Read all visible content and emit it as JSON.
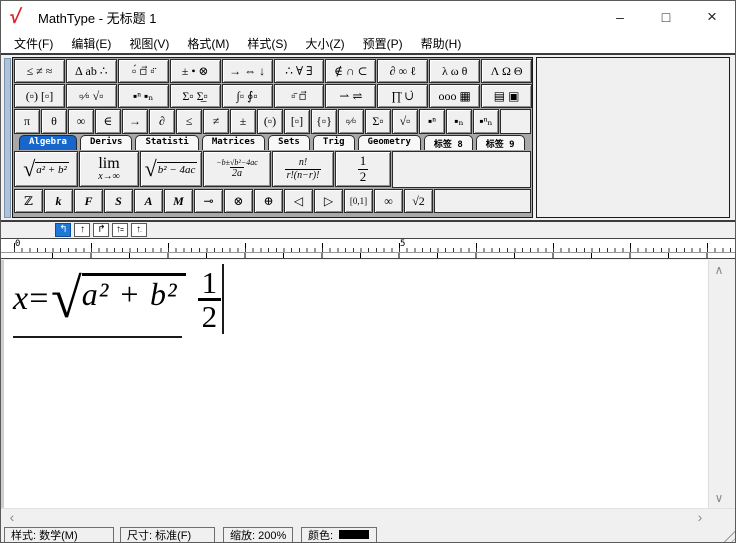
{
  "window": {
    "title": "MathType - 无标题 1",
    "logo_glyph": "√",
    "controls": {
      "minimize": "–",
      "maximize": "□",
      "close": "×"
    }
  },
  "colors": {
    "tab_selected": "#1666cc",
    "logo_red": "#d8232a",
    "grip_blue": "#aec2da",
    "status_color_value": "#000000"
  },
  "menu": {
    "items": [
      {
        "label": "文件(F)"
      },
      {
        "label": "编辑(E)"
      },
      {
        "label": "视图(V)"
      },
      {
        "label": "格式(M)"
      },
      {
        "label": "样式(S)"
      },
      {
        "label": "大小(Z)"
      },
      {
        "label": "预置(P)"
      },
      {
        "label": "帮助(H)"
      }
    ]
  },
  "palette_row1": [
    {
      "name": "relational-symbols",
      "glyph": "≤ ≠ ≈"
    },
    {
      "name": "spacing-ellipses",
      "glyph": "∆ ab ∴"
    },
    {
      "name": "embellishments",
      "glyph": "▫́ ▫⃗ ▫̈"
    },
    {
      "name": "operator-symbols",
      "glyph": "± • ⊗"
    },
    {
      "name": "arrow-symbols",
      "glyph": "→ ⇔ ↓"
    },
    {
      "name": "logic-symbols",
      "glyph": "∴ ∀ ∃"
    },
    {
      "name": "set-theory-symbols",
      "glyph": "∉ ∩ ⊂"
    },
    {
      "name": "misc-symbols",
      "glyph": "∂ ∞ ℓ"
    },
    {
      "name": "greek-lowercase",
      "glyph": "λ ω θ"
    },
    {
      "name": "greek-uppercase",
      "glyph": "Λ Ω Θ"
    }
  ],
  "palette_row2": [
    {
      "name": "fence-templates",
      "glyph": "(▫) [▫]"
    },
    {
      "name": "fraction-radical-templates",
      "glyph": "▫⁄▫ √▫"
    },
    {
      "name": "script-templates",
      "glyph": "▪ⁿ ▪ₙ"
    },
    {
      "name": "sum-templates",
      "glyph": "Σ▫ Σ̲▫"
    },
    {
      "name": "integral-templates",
      "glyph": "∫▫ ∮▫"
    },
    {
      "name": "overbar-templates",
      "glyph": "▫̄ ▫⃗"
    },
    {
      "name": "labeled-arrow-templates",
      "glyph": "⇀ ⇌"
    },
    {
      "name": "product-union-templates",
      "glyph": "∏̇ ∪̇"
    },
    {
      "name": "matrix-templates",
      "glyph": "ooo ▦"
    },
    {
      "name": "box-templates",
      "glyph": "▤ ▣"
    }
  ],
  "small_row": [
    {
      "name": "pi",
      "glyph": "π"
    },
    {
      "name": "theta",
      "glyph": "θ"
    },
    {
      "name": "infinity",
      "glyph": "∞"
    },
    {
      "name": "element-of",
      "glyph": "∈"
    },
    {
      "name": "right-arrow",
      "glyph": "→"
    },
    {
      "name": "partial",
      "glyph": "∂"
    },
    {
      "name": "less-equal",
      "glyph": "≤"
    },
    {
      "name": "not-equal",
      "glyph": "≠"
    },
    {
      "name": "plus-minus",
      "glyph": "±"
    },
    {
      "name": "parentheses",
      "glyph": "(▫)"
    },
    {
      "name": "brackets",
      "glyph": "[▫]"
    },
    {
      "name": "braces",
      "glyph": "{▫}"
    },
    {
      "name": "fraction",
      "glyph": "▫⁄▫"
    },
    {
      "name": "summation",
      "glyph": "Σ▫"
    },
    {
      "name": "square-root",
      "glyph": "√▫"
    },
    {
      "name": "superscript",
      "glyph": "▪ⁿ"
    },
    {
      "name": "subscript",
      "glyph": "▪ₙ"
    },
    {
      "name": "sub-superscript",
      "glyph": "▪ⁿₙ"
    }
  ],
  "tabs": {
    "items": [
      {
        "label": "Algebra",
        "selected": true
      },
      {
        "label": "Derivs",
        "selected": false
      },
      {
        "label": "Statisti",
        "selected": false
      },
      {
        "label": "Matrices",
        "selected": false
      },
      {
        "label": "Sets",
        "selected": false
      },
      {
        "label": "Trig",
        "selected": false
      },
      {
        "label": "Geometry",
        "selected": false
      },
      {
        "label": "标签 8",
        "selected": false
      },
      {
        "label": "标签 9",
        "selected": false
      }
    ]
  },
  "templates": [
    {
      "name": "sqrt-a2-plus-b2",
      "sign": "√",
      "radicand": "a² + b²"
    },
    {
      "name": "limit-x-to-infinity",
      "top": "lim",
      "bottom": "x→∞"
    },
    {
      "name": "sqrt-b2-minus-4ac",
      "sign": "√",
      "radicand": "b² − 4ac"
    },
    {
      "name": "quadratic-formula",
      "num": "−b±√b²−4ac",
      "den": "2a"
    },
    {
      "name": "combination-formula",
      "num": "n!",
      "den": "r!(n−r)!"
    },
    {
      "name": "one-half",
      "num": "1",
      "den": "2"
    }
  ],
  "char_row": [
    {
      "name": "blackboard-z",
      "glyph": "ℤ"
    },
    {
      "name": "letter-k",
      "glyph": "k"
    },
    {
      "name": "letter-f",
      "glyph": "F"
    },
    {
      "name": "letter-s",
      "glyph": "S"
    },
    {
      "name": "fraktur-a",
      "glyph": "A"
    },
    {
      "name": "fraktur-m",
      "glyph": "M"
    },
    {
      "name": "multimap",
      "glyph": "⊸"
    },
    {
      "name": "circled-times",
      "glyph": "⊗"
    },
    {
      "name": "circled-plus",
      "glyph": "⊕"
    },
    {
      "name": "triangle-left",
      "glyph": "◁"
    },
    {
      "name": "triangle-right",
      "glyph": "▷"
    },
    {
      "name": "interval-01",
      "glyph": "[0,1]"
    },
    {
      "name": "infinity",
      "glyph": "∞"
    },
    {
      "name": "sqrt-2",
      "glyph": "√2"
    }
  ],
  "tabstops": [
    {
      "name": "tab-left",
      "glyph": "↰",
      "suffix": "",
      "selected": true
    },
    {
      "name": "tab-center",
      "glyph": "↑",
      "suffix": "",
      "selected": false
    },
    {
      "name": "tab-right",
      "glyph": "↱",
      "suffix": "",
      "selected": false
    },
    {
      "name": "tab-equal",
      "glyph": "↑",
      "suffix": "=",
      "selected": false
    },
    {
      "name": "tab-decimal",
      "glyph": "↑",
      "suffix": ".",
      "selected": false
    }
  ],
  "ruler": {
    "zero": "0",
    "five": "5"
  },
  "formula": {
    "lhs": "x=",
    "sign": "√",
    "radicand": "a² + b²",
    "num": "1",
    "den": "2"
  },
  "scroll": {
    "up": "∧",
    "down": "∨",
    "left": "‹",
    "right": "›"
  },
  "status": {
    "style": "样式: 数学(M)",
    "size": "尺寸: 标准(F)",
    "zoom": "缩放: 200%",
    "color_label": "颜色:"
  }
}
